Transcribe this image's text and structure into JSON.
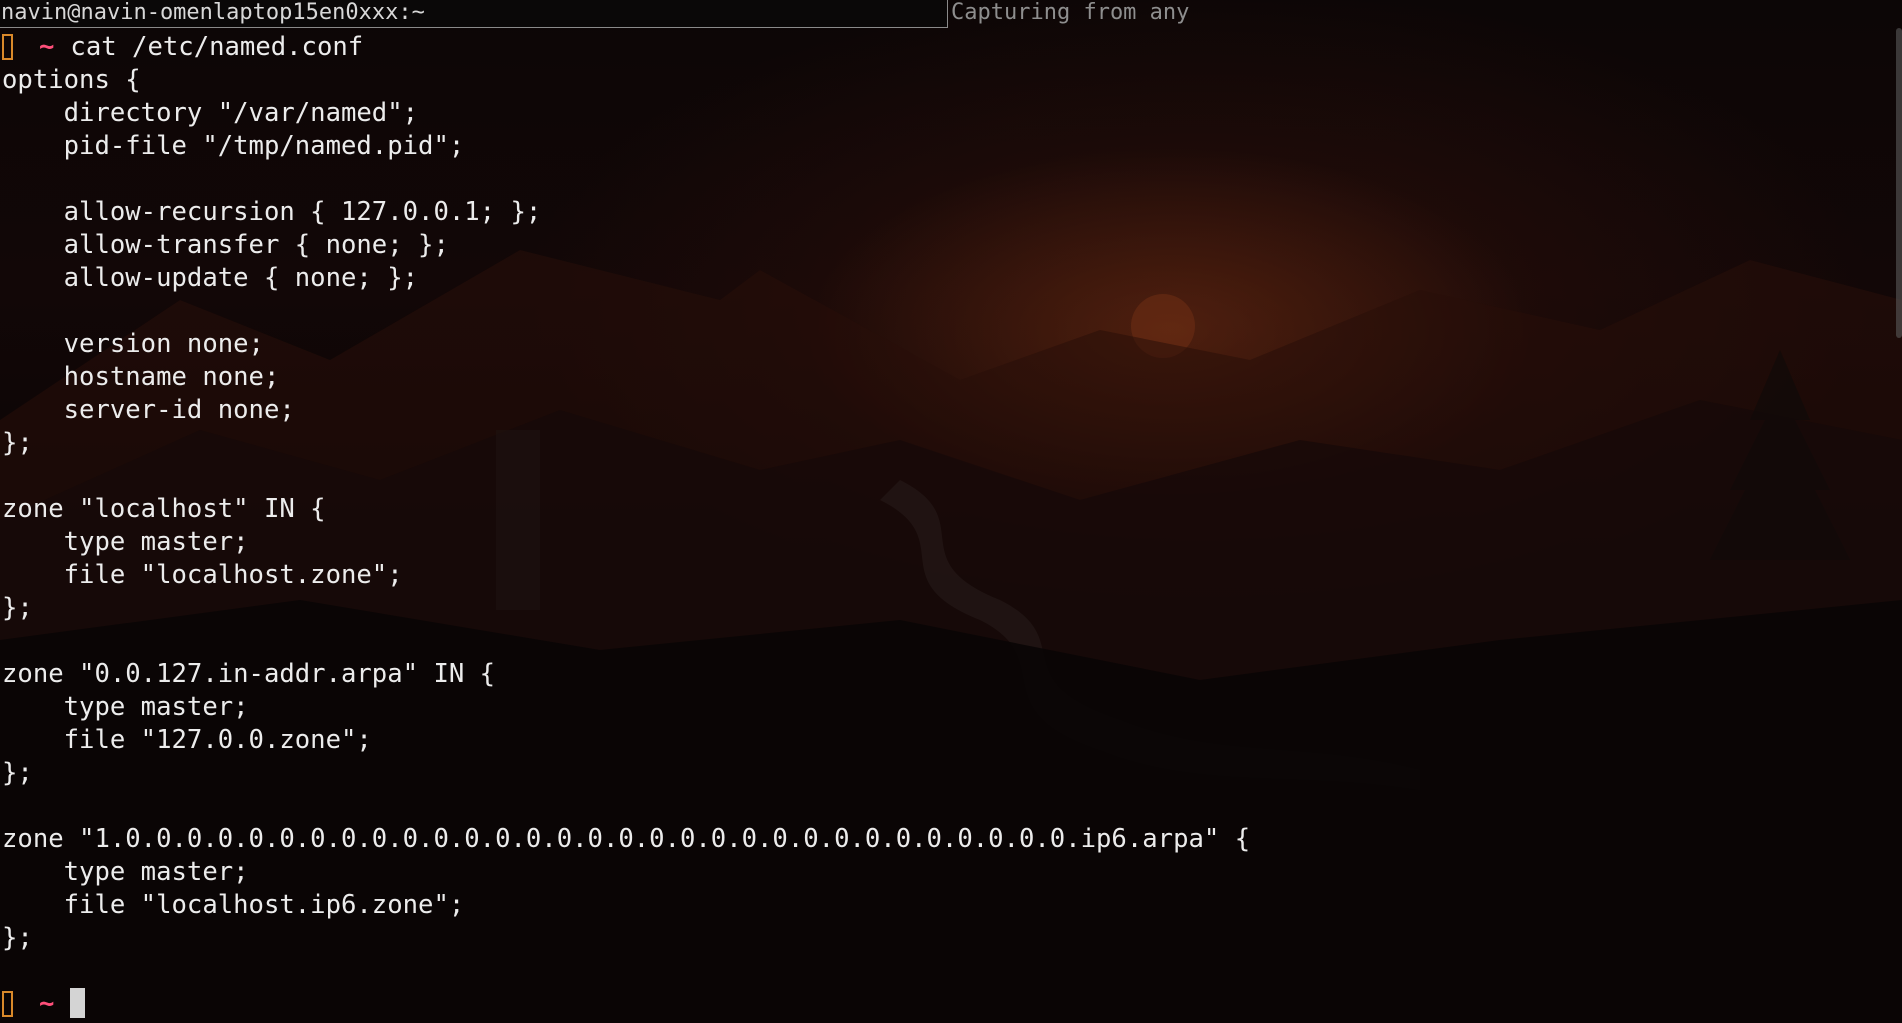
{
  "window": {
    "title": "navin@navin-omenlaptop15en0xxx:~",
    "status": "Capturing from any"
  },
  "terminal": {
    "prompt_symbol": "~",
    "command": "cat /etc/named.conf",
    "output": [
      "options {",
      "    directory \"/var/named\";",
      "    pid-file \"/tmp/named.pid\";",
      "",
      "    allow-recursion { 127.0.0.1; };",
      "    allow-transfer { none; };",
      "    allow-update { none; };",
      "",
      "    version none;",
      "    hostname none;",
      "    server-id none;",
      "};",
      "",
      "zone \"localhost\" IN {",
      "    type master;",
      "    file \"localhost.zone\";",
      "};",
      "",
      "zone \"0.0.127.in-addr.arpa\" IN {",
      "    type master;",
      "    file \"127.0.0.zone\";",
      "};",
      "",
      "zone \"1.0.0.0.0.0.0.0.0.0.0.0.0.0.0.0.0.0.0.0.0.0.0.0.0.0.0.0.0.0.0.0.ip6.arpa\" {",
      "    type master;",
      "    file \"localhost.ip6.zone\";",
      "};",
      ""
    ]
  },
  "colors": {
    "prompt_box": "#d9892a",
    "tilde": "#ff4f7a",
    "text": "#ececec"
  }
}
